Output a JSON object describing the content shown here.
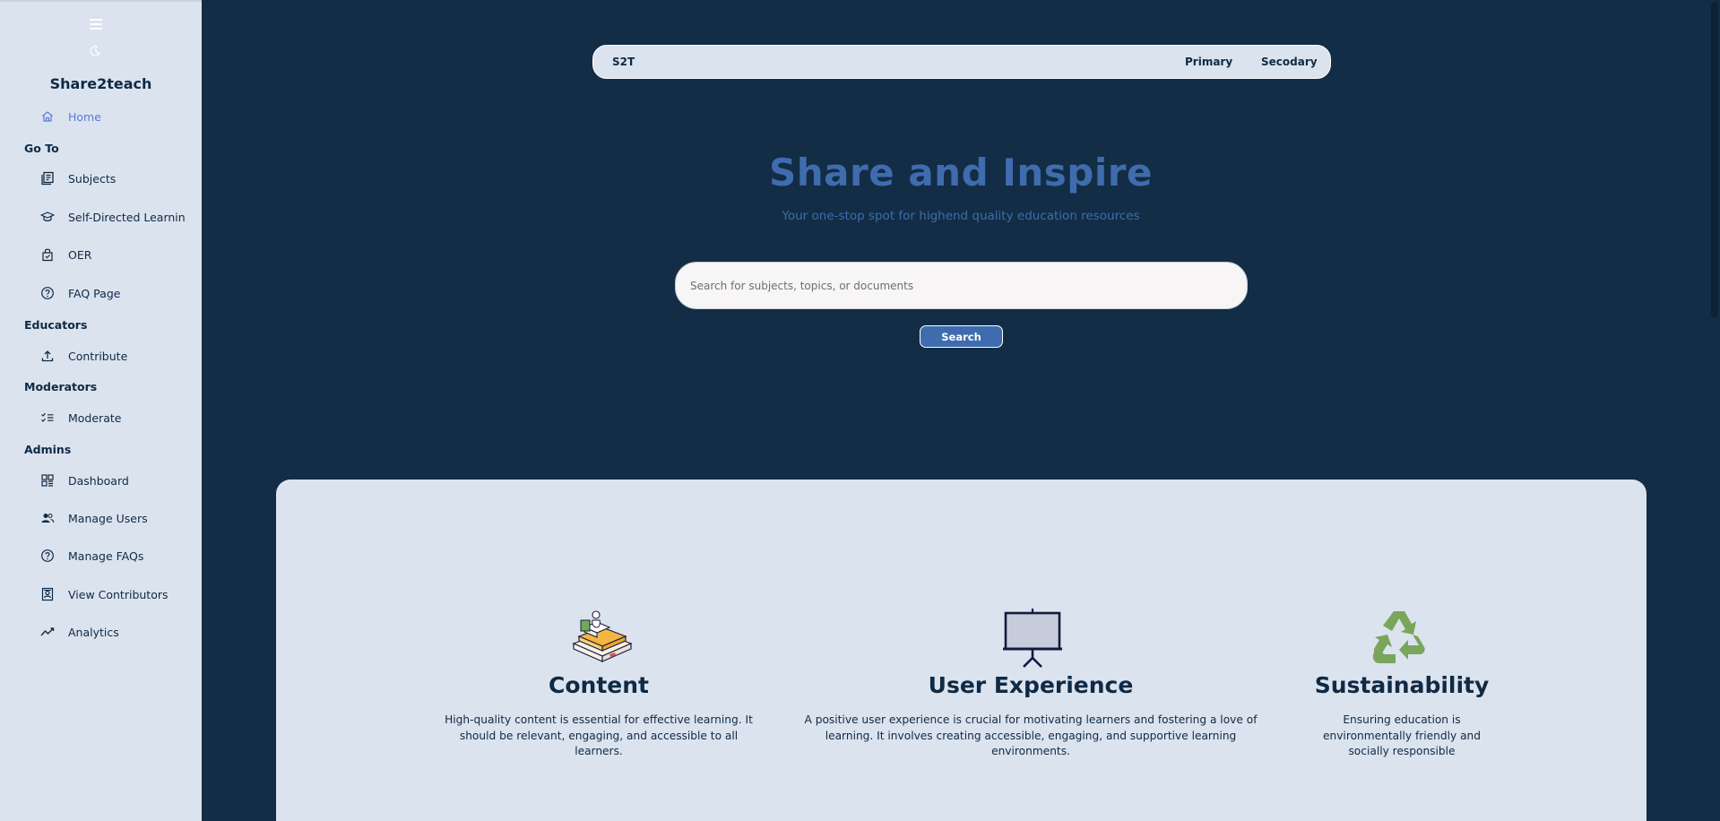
{
  "app": {
    "brand": "Share2teach"
  },
  "sidebar": {
    "home": {
      "label": "Home",
      "icon": "home-icon"
    },
    "sections": [
      {
        "label": "Go To",
        "items": [
          {
            "label": "Subjects",
            "icon": "subjects-icon"
          },
          {
            "label": "Self-Directed Learnin",
            "icon": "graduation-cap-icon"
          },
          {
            "label": "OER",
            "icon": "oer-icon"
          },
          {
            "label": "FAQ Page",
            "icon": "question-icon"
          }
        ]
      },
      {
        "label": "Educators",
        "items": [
          {
            "label": "Contribute",
            "icon": "upload-icon"
          }
        ]
      },
      {
        "label": "Moderators",
        "items": [
          {
            "label": "Moderate",
            "icon": "checklist-icon"
          }
        ]
      },
      {
        "label": "Admins",
        "items": [
          {
            "label": "Dashboard",
            "icon": "dashboard-icon"
          },
          {
            "label": "Manage Users",
            "icon": "users-icon"
          },
          {
            "label": "Manage FAQs",
            "icon": "question-icon"
          },
          {
            "label": "View Contributors",
            "icon": "contributors-icon"
          },
          {
            "label": "Analytics",
            "icon": "analytics-icon"
          }
        ]
      }
    ]
  },
  "topnav": {
    "logo": "S2T",
    "links": [
      "Primary",
      "Secodary"
    ]
  },
  "hero": {
    "title": "Share and Inspire",
    "subtitle": "Your one-stop spot for highend quality education resources",
    "search_placeholder": "Search for subjects, topics, or documents",
    "search_button": "Search"
  },
  "features": [
    {
      "title": "Content",
      "text": "High-quality content is essential for effective learning. It should be relevant, engaging, and accessible to all learners.",
      "icon": "books-icon"
    },
    {
      "title": "User Experience",
      "text": "A positive user experience is crucial for motivating learners and fostering a love of learning. It involves creating accessible, engaging, and supportive learning environments.",
      "icon": "presentation-board-icon"
    },
    {
      "title": "Sustainability",
      "text": "Ensuring education is environmentally friendly and socially responsible",
      "icon": "recycle-icon"
    }
  ],
  "colors": {
    "background": "#122d45",
    "panel": "#dbe3ef",
    "accent": "#3f6cae",
    "active_link": "#5b79d6",
    "text": "#0f2a44"
  }
}
